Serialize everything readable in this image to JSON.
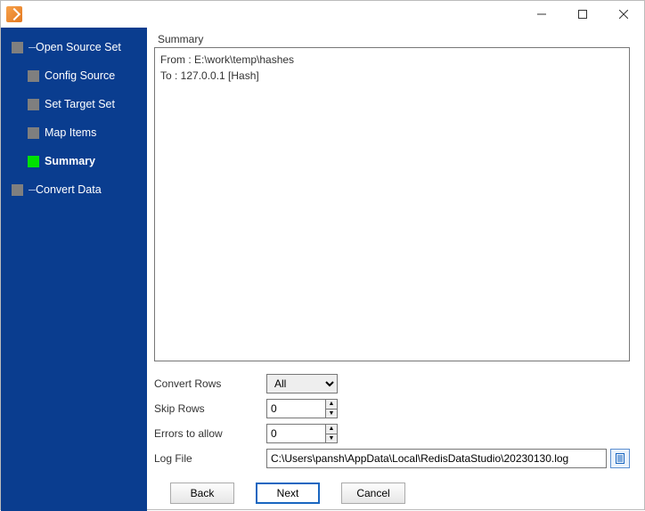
{
  "window": {
    "minimize_title": "Minimize",
    "maximize_title": "Maximize",
    "close_title": "Close"
  },
  "sidebar": {
    "steps": [
      {
        "label": "Open Source Set",
        "sub": false,
        "current": false
      },
      {
        "label": "Config Source",
        "sub": true,
        "current": false
      },
      {
        "label": "Set Target Set",
        "sub": true,
        "current": false
      },
      {
        "label": "Map Items",
        "sub": true,
        "current": false
      },
      {
        "label": "Summary",
        "sub": true,
        "current": true
      },
      {
        "label": "Convert Data",
        "sub": false,
        "current": false
      }
    ]
  },
  "panel": {
    "title": "Summary",
    "summary_lines": {
      "from": "From : E:\\work\\temp\\hashes",
      "to": "To : 127.0.0.1 [Hash]"
    }
  },
  "form": {
    "convert_rows_label": "Convert Rows",
    "convert_rows_value": "All",
    "skip_rows_label": "Skip Rows",
    "skip_rows_value": "0",
    "errors_label": "Errors to allow",
    "errors_value": "0",
    "log_file_label": "Log File",
    "log_file_value": "C:\\Users\\pansh\\AppData\\Local\\RedisDataStudio\\20230130.log"
  },
  "buttons": {
    "back": "Back",
    "next": "Next",
    "cancel": "Cancel"
  }
}
